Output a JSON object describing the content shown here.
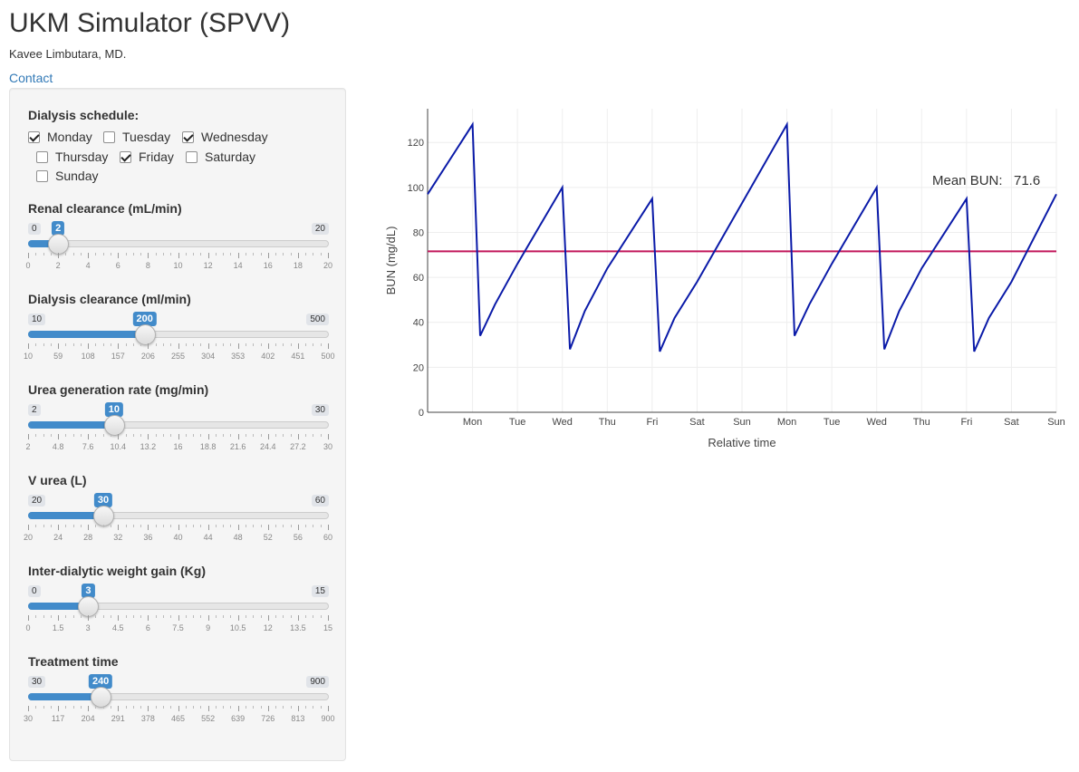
{
  "header": {
    "title": "UKM Simulator (SPVV)",
    "author": "Kavee Limbutara, MD.",
    "contact_label": "Contact"
  },
  "schedule": {
    "label": "Dialysis schedule:",
    "days": [
      {
        "label": "Monday",
        "checked": true
      },
      {
        "label": "Tuesday",
        "checked": false
      },
      {
        "label": "Wednesday",
        "checked": true
      },
      {
        "label": "Thursday",
        "checked": false
      },
      {
        "label": "Friday",
        "checked": true
      },
      {
        "label": "Saturday",
        "checked": false
      },
      {
        "label": "Sunday",
        "checked": false
      }
    ]
  },
  "sliders": [
    {
      "label": "Renal clearance (mL/min)",
      "min": 0,
      "max": 20,
      "value": 2,
      "min_label": "0",
      "max_label": "20",
      "value_label": "2",
      "ticks": [
        "0",
        "2",
        "4",
        "6",
        "8",
        "10",
        "12",
        "14",
        "16",
        "18",
        "20"
      ]
    },
    {
      "label": "Dialysis clearance (ml/min)",
      "min": 10,
      "max": 500,
      "value": 200,
      "min_label": "10",
      "max_label": "500",
      "value_label": "200",
      "ticks": [
        "10",
        "59",
        "108",
        "157",
        "206",
        "255",
        "304",
        "353",
        "402",
        "451",
        "500"
      ]
    },
    {
      "label": "Urea generation rate (mg/min)",
      "min": 2,
      "max": 30,
      "value": 10,
      "min_label": "2",
      "max_label": "30",
      "value_label": "10",
      "ticks": [
        "2",
        "4.8",
        "7.6",
        "10.4",
        "13.2",
        "16",
        "18.8",
        "21.6",
        "24.4",
        "27.2",
        "30"
      ]
    },
    {
      "label": "V urea (L)",
      "min": 20,
      "max": 60,
      "value": 30,
      "min_label": "20",
      "max_label": "60",
      "value_label": "30",
      "ticks": [
        "20",
        "24",
        "28",
        "32",
        "36",
        "40",
        "44",
        "48",
        "52",
        "56",
        "60"
      ]
    },
    {
      "label": "Inter-dialytic weight gain (Kg)",
      "min": 0,
      "max": 15,
      "value": 3,
      "min_label": "0",
      "max_label": "15",
      "value_label": "3",
      "ticks": [
        "0",
        "1.5",
        "3",
        "4.5",
        "6",
        "7.5",
        "9",
        "10.5",
        "12",
        "13.5",
        "15"
      ]
    },
    {
      "label": "Treatment time",
      "min": 30,
      "max": 900,
      "value": 240,
      "min_label": "30",
      "max_label": "900",
      "value_label": "240",
      "ticks": [
        "30",
        "117",
        "204",
        "291",
        "378",
        "465",
        "552",
        "639",
        "726",
        "813",
        "900"
      ]
    }
  ],
  "chart_data": {
    "type": "line",
    "xlabel": "Relative time",
    "ylabel": "BUN (mg/dL)",
    "ylim": [
      0,
      135
    ],
    "yticks": [
      0,
      20,
      40,
      60,
      80,
      100,
      120
    ],
    "xlim": [
      0,
      14
    ],
    "x_tick_labels": [
      "Mon",
      "Tue",
      "Wed",
      "Thu",
      "Fri",
      "Sat",
      "Sun",
      "Mon",
      "Tue",
      "Wed",
      "Thu",
      "Fri",
      "Sat",
      "Sun"
    ],
    "x_tick_positions": [
      1,
      2,
      3,
      4,
      5,
      6,
      7,
      8,
      9,
      10,
      11,
      12,
      13,
      14
    ],
    "grid": true,
    "series": [
      {
        "color": "#0a1aa8",
        "points": [
          [
            0,
            97
          ],
          [
            1,
            128
          ],
          [
            1.17,
            34
          ],
          [
            1.5,
            48
          ],
          [
            2,
            66
          ],
          [
            3,
            100
          ],
          [
            3.17,
            28
          ],
          [
            3.5,
            45
          ],
          [
            4,
            64
          ],
          [
            5,
            95
          ],
          [
            5.17,
            27
          ],
          [
            5.5,
            42
          ],
          [
            6,
            58
          ],
          [
            7,
            93
          ],
          [
            8,
            128
          ],
          [
            8.17,
            34
          ],
          [
            8.5,
            48
          ],
          [
            9,
            66
          ],
          [
            10,
            100
          ],
          [
            10.17,
            28
          ],
          [
            10.5,
            45
          ],
          [
            11,
            64
          ],
          [
            12,
            95
          ],
          [
            12.17,
            27
          ],
          [
            12.5,
            42
          ],
          [
            13,
            58
          ],
          [
            14,
            97
          ]
        ]
      }
    ],
    "mean_line": {
      "value": 71.6,
      "color": "#c2185b"
    },
    "annotation": {
      "label": "Mean BUN:",
      "value": "71.6"
    }
  }
}
